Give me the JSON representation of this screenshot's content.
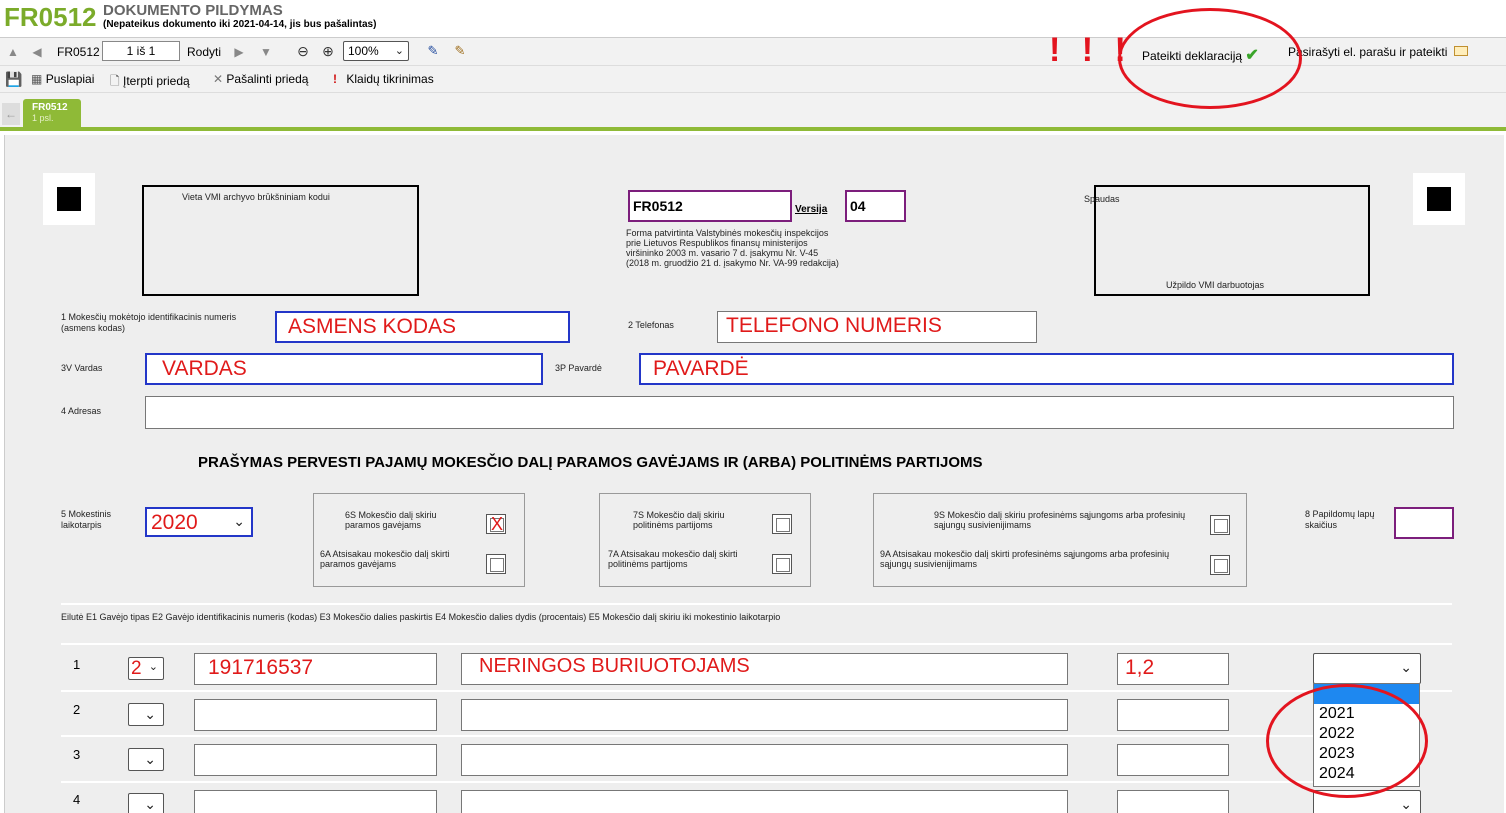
{
  "header": {
    "code": "FR0512",
    "title": "DOKUMENTO PILDYMAS",
    "note": "(Nepateikus dokumento iki 2021-04-14, jis bus pašalintas)"
  },
  "toolbar1": {
    "form_code": "FR0512",
    "page_value": "1 iš 1",
    "show_label": "Rodyti",
    "zoom_value": "100%",
    "submit_label": "Pateikti deklaraciją",
    "sign_label": "Pasirašyti el. parašu ir pateikti",
    "annotation": "! ! !"
  },
  "toolbar2": {
    "pages_label": "Puslapiai",
    "insert_label": "Įterpti priedą",
    "remove_label": "Pašalinti priedą",
    "errors_label": "Klaidų tikrinimas"
  },
  "tab": {
    "title": "FR0512",
    "sub": "1 psl."
  },
  "form": {
    "archive_label": "Vieta VMI archyvo brūkšniniam kodui",
    "form_code_value": "FR0512",
    "version_label": "Versija",
    "version_value": "04",
    "approval_note": "Forma patvirtinta Valstybinės mokesčių inspekcijos prie Lietuvos Respublikos finansų ministerijos viršininko 2003 m. vasario 7 d. įsakymu Nr. V-45 (2018 m. gruodžio 21 d. įsakymo Nr. VA-99 redakcija)",
    "stamp_label": "Spaudas",
    "stamp_fill": "Užpildo VMI darbuotojas",
    "f1_label": "1 Mokesčių mokėtojo identifikacinis numeris (asmens kodas)",
    "f1_value": "ASMENS KODAS",
    "f2_label": "2 Telefonas",
    "f2_value": "TELEFONO NUMERIS",
    "f3v_label": "3V Vardas",
    "f3v_value": "VARDAS",
    "f3p_label": "3P Pavardė",
    "f3p_value": "PAVARDĖ",
    "f4_label": "4 Adresas",
    "heading": "PRAŠYMAS PERVESTI PAJAMŲ MOKESČIO DALĮ PARAMOS GAVĖJAMS IR (ARBA) POLITINĖMS PARTIJOMS",
    "f5_label": "5 Mokestinis laikotarpis",
    "f5_value": "2020",
    "g6s": "6S Mokesčio dalį skiriu paramos gavėjams",
    "g6s_mark": "X",
    "g6a": "6A Atsisakau mokesčio dalį skirti paramos gavėjams",
    "g7s": "7S Mokesčio dalį skiriu politinėms partijoms",
    "g7a": "7A Atsisakau mokesčio dalį skirti politinėms partijoms",
    "g9s": "9S Mokesčio dalį skiriu profesinėms sąjungoms arba profesinių sąjungų susivienijimams",
    "g9a": "9A Atsisakau mokesčio dalį skirti profesinėms sąjungoms arba profesinių sąjungų susivienijimams",
    "f8_label": "8 Papildomų lapų skaičius",
    "table_header": "Eilutė E1 Gavėjo tipas E2 Gavėjo identifikacinis numeris (kodas) E3 Mokesčio dalies paskirtis E4 Mokesčio dalies dydis (procentais) E5 Mokesčio dalį skiriu iki mokestinio laikotarpio",
    "rows": [
      {
        "num": "1",
        "type": "2",
        "code": "191716537",
        "purpose": "NERINGOS BURIUOTOJAMS",
        "percent": "1,2"
      },
      {
        "num": "2",
        "type": "",
        "code": "",
        "purpose": "",
        "percent": ""
      },
      {
        "num": "3",
        "type": "",
        "code": "",
        "purpose": "",
        "percent": ""
      },
      {
        "num": "4",
        "type": "",
        "code": "",
        "purpose": "",
        "percent": ""
      }
    ],
    "year_options": [
      "",
      "2021",
      "2022",
      "2023",
      "2024"
    ]
  }
}
